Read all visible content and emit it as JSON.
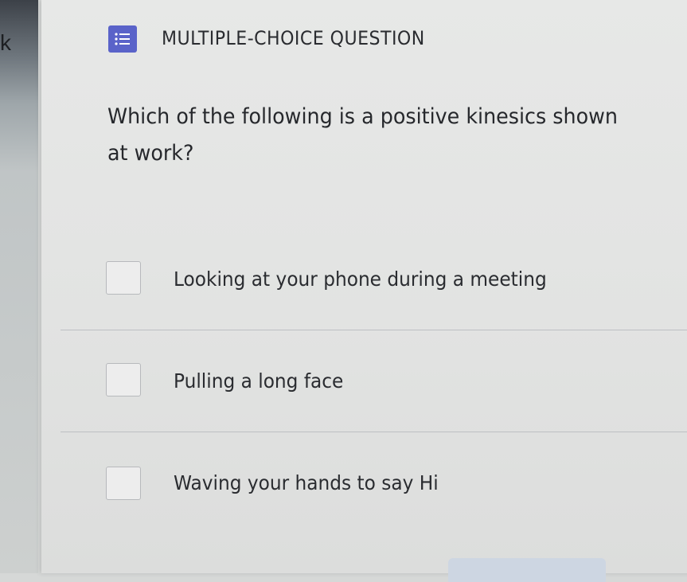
{
  "sidebar": {
    "partial_text": "k"
  },
  "question": {
    "type_label": "MULTIPLE-CHOICE QUESTION",
    "type_icon": "checklist-icon",
    "text": "Which of the following is a positive kinesics shown at work?"
  },
  "options": [
    {
      "label": "Looking at your phone during a meeting",
      "checked": false
    },
    {
      "label": "Pulling a long face",
      "checked": false
    },
    {
      "label": "Waving your hands to say Hi",
      "checked": false
    }
  ],
  "colors": {
    "icon_bg": "#5a63c9",
    "card_bg": "#e4e5e4",
    "divider": "#bdbfc3"
  }
}
